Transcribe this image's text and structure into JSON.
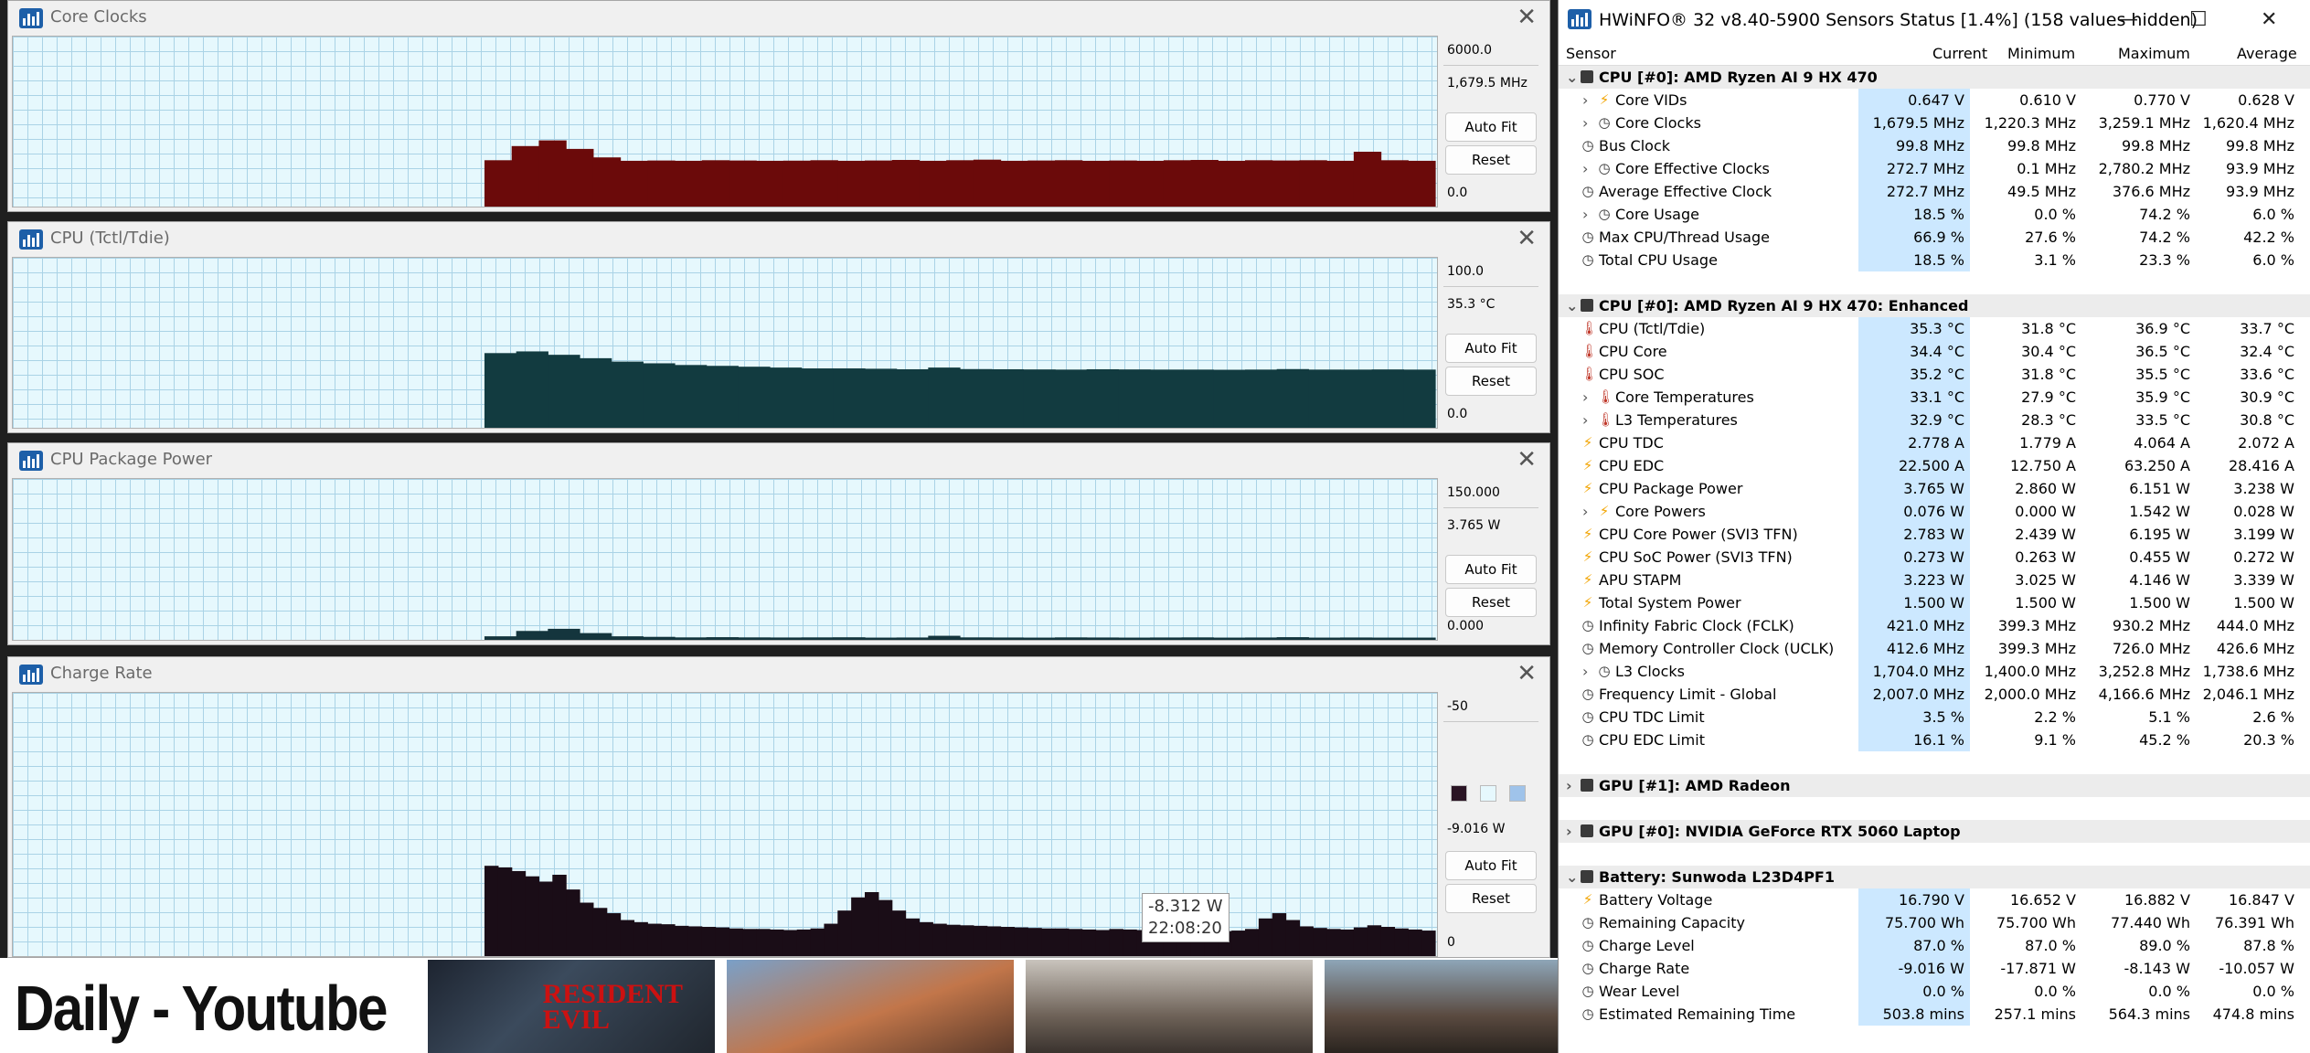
{
  "background": {
    "title": "Daily - Youtube",
    "thumbnail_caption": "RESIDENT EVIL"
  },
  "graphs": [
    {
      "title": "Core Clocks",
      "scale_max": "6000.0",
      "current": "1,679.5 MHz",
      "scale_min": "0.0",
      "fill_color": "#6b0a0a",
      "buttons": [
        "Auto Fit",
        "Reset"
      ],
      "chart_data": {
        "type": "area",
        "y_range": [
          0,
          6000
        ],
        "values": [
          1700,
          2200,
          2400,
          2100,
          1800,
          1680,
          1690,
          1680,
          1700,
          1690,
          1680,
          1685,
          1700,
          1680,
          1690,
          1710,
          1680,
          1700,
          1720,
          1680,
          1690,
          1700,
          1680,
          1690,
          1680,
          1700,
          1710,
          1680,
          1700,
          1690,
          1700,
          1680,
          2000,
          1700,
          1680
        ]
      }
    },
    {
      "title": "CPU (Tctl/Tdie)",
      "scale_max": "100.0",
      "current": "35.3 °C",
      "scale_min": "0.0",
      "fill_color": "#123b40",
      "buttons": [
        "Auto Fit",
        "Reset"
      ],
      "chart_data": {
        "type": "area",
        "y_range": [
          0,
          100
        ],
        "values": [
          45,
          46,
          44,
          42,
          40,
          39,
          38,
          37.5,
          37,
          36.5,
          36,
          36,
          35.8,
          35.5,
          36.5,
          35.6,
          35.5,
          35.4,
          35.3,
          35.5,
          35.4,
          35.3,
          35.3,
          35.2,
          35.3,
          35.6,
          35.3,
          35.3,
          35.4,
          35.3
        ]
      }
    },
    {
      "title": "CPU Package Power",
      "scale_max": "150.000",
      "current": "3.765 W",
      "scale_min": "0.000",
      "fill_color": "#14353d",
      "buttons": [
        "Auto Fit",
        "Reset"
      ],
      "chart_data": {
        "type": "area",
        "y_range": [
          0,
          150
        ],
        "values": [
          5,
          10,
          12,
          8,
          5,
          4.5,
          4,
          4.2,
          4,
          3.9,
          4,
          4.1,
          3.8,
          3.9,
          5.5,
          4,
          3.9,
          3.8,
          4,
          3.9,
          3.8,
          3.9,
          4,
          3.8,
          3.9,
          4.2,
          3.8,
          3.9,
          3.8,
          3.8
        ]
      }
    },
    {
      "title": "Charge Rate",
      "scale_max": "-50",
      "current": "-9.016 W",
      "scale_min": "0",
      "fill_color": "#1a0d17",
      "buttons": [
        "Auto Fit",
        "Reset"
      ],
      "tooltip_value": "-8.312 W",
      "tooltip_time": "22:08:20",
      "chart_data": {
        "type": "area",
        "y_range": [
          0,
          -50
        ],
        "values": [
          -17.5,
          -17.2,
          -16.5,
          -15.5,
          -14.5,
          -15.8,
          -13,
          -10.5,
          -9.5,
          -8.5,
          -7.2,
          -6.8,
          -6.5,
          -6.4,
          -6.1,
          -6,
          -5.9,
          -5.8,
          -5.6,
          -5.5,
          -5.5,
          -5.4,
          -5.3,
          -5.4,
          -5.6,
          -6.5,
          -9,
          -11.5,
          -12.5,
          -11,
          -9,
          -7.5,
          -6.8,
          -6.5,
          -6.3,
          -6.2,
          -6.1,
          -6,
          -5.9,
          -5.8,
          -5.7,
          -5.6,
          -5.6,
          -5.5,
          -5.4,
          -5.3,
          -5.5,
          -5.4,
          -5.3,
          -5.2,
          -5.4,
          -5.6,
          -5.3,
          -5.2,
          -5.1,
          -5.2,
          -5.5,
          -7.5,
          -8.5,
          -7.2,
          -6,
          -5.7,
          -5.5,
          -5.4,
          -5.8,
          -6.2,
          -5.9,
          -5.6,
          -5.4,
          -5.2
        ]
      }
    }
  ],
  "sensors": {
    "title": "HWiNFO® 32 v8.40-5900 Sensors Status [1.4%] (158 values hidden)",
    "window_buttons": [
      "—",
      "☐",
      "✕"
    ],
    "columns": [
      "Sensor",
      "Current",
      "Minimum",
      "Maximum",
      "Average"
    ],
    "rows": [
      {
        "type": "group",
        "name": "CPU [#0]: AMD Ryzen AI 9 HX 470",
        "expanded": true
      },
      {
        "type": "item",
        "name": "Core VIDs",
        "icon": "bolt",
        "sub": true,
        "cur": "0.647 V",
        "min": "0.610 V",
        "max": "0.770 V",
        "avg": "0.628 V"
      },
      {
        "type": "item",
        "name": "Core Clocks",
        "icon": "clock",
        "sub": true,
        "cur": "1,679.5 MHz",
        "min": "1,220.3 MHz",
        "max": "3,259.1 MHz",
        "avg": "1,620.4 MHz"
      },
      {
        "type": "item",
        "name": "Bus Clock",
        "icon": "clock",
        "cur": "99.8 MHz",
        "min": "99.8 MHz",
        "max": "99.8 MHz",
        "avg": "99.8 MHz"
      },
      {
        "type": "item",
        "name": "Core Effective Clocks",
        "icon": "clock",
        "sub": true,
        "cur": "272.7 MHz",
        "min": "0.1 MHz",
        "max": "2,780.2 MHz",
        "avg": "93.9 MHz"
      },
      {
        "type": "item",
        "name": "Average Effective Clock",
        "icon": "clock",
        "cur": "272.7 MHz",
        "min": "49.5 MHz",
        "max": "376.6 MHz",
        "avg": "93.9 MHz"
      },
      {
        "type": "item",
        "name": "Core Usage",
        "icon": "clock",
        "sub": true,
        "cur": "18.5 %",
        "min": "0.0 %",
        "max": "74.2 %",
        "avg": "6.0 %"
      },
      {
        "type": "item",
        "name": "Max CPU/Thread Usage",
        "icon": "clock",
        "cur": "66.9 %",
        "min": "27.6 %",
        "max": "74.2 %",
        "avg": "42.2 %"
      },
      {
        "type": "item",
        "name": "Total CPU Usage",
        "icon": "clock",
        "cur": "18.5 %",
        "min": "3.1 %",
        "max": "23.3 %",
        "avg": "6.0 %"
      },
      {
        "type": "blank"
      },
      {
        "type": "group",
        "name": "CPU [#0]: AMD Ryzen AI 9 HX 470: Enhanced",
        "expanded": true
      },
      {
        "type": "item",
        "name": "CPU (Tctl/Tdie)",
        "icon": "therm",
        "cur": "35.3 °C",
        "min": "31.8 °C",
        "max": "36.9 °C",
        "avg": "33.7 °C"
      },
      {
        "type": "item",
        "name": "CPU Core",
        "icon": "therm",
        "cur": "34.4 °C",
        "min": "30.4 °C",
        "max": "36.5 °C",
        "avg": "32.4 °C"
      },
      {
        "type": "item",
        "name": "CPU SOC",
        "icon": "therm",
        "cur": "35.2 °C",
        "min": "31.8 °C",
        "max": "35.5 °C",
        "avg": "33.6 °C"
      },
      {
        "type": "item",
        "name": "Core Temperatures",
        "icon": "therm",
        "sub": true,
        "cur": "33.1 °C",
        "min": "27.9 °C",
        "max": "35.9 °C",
        "avg": "30.9 °C"
      },
      {
        "type": "item",
        "name": "L3 Temperatures",
        "icon": "therm",
        "sub": true,
        "cur": "32.9 °C",
        "min": "28.3 °C",
        "max": "33.5 °C",
        "avg": "30.8 °C"
      },
      {
        "type": "item",
        "name": "CPU TDC",
        "icon": "bolt",
        "cur": "2.778 A",
        "min": "1.779 A",
        "max": "4.064 A",
        "avg": "2.072 A"
      },
      {
        "type": "item",
        "name": "CPU EDC",
        "icon": "bolt",
        "cur": "22.500 A",
        "min": "12.750 A",
        "max": "63.250 A",
        "avg": "28.416 A"
      },
      {
        "type": "item",
        "name": "CPU Package Power",
        "icon": "bolt",
        "cur": "3.765 W",
        "min": "2.860 W",
        "max": "6.151 W",
        "avg": "3.238 W"
      },
      {
        "type": "item",
        "name": "Core Powers",
        "icon": "bolt",
        "sub": true,
        "cur": "0.076 W",
        "min": "0.000 W",
        "max": "1.542 W",
        "avg": "0.028 W"
      },
      {
        "type": "item",
        "name": "CPU Core Power (SVI3 TFN)",
        "icon": "bolt",
        "cur": "2.783 W",
        "min": "2.439 W",
        "max": "6.195 W",
        "avg": "3.199 W"
      },
      {
        "type": "item",
        "name": "CPU SoC Power (SVI3 TFN)",
        "icon": "bolt",
        "cur": "0.273 W",
        "min": "0.263 W",
        "max": "0.455 W",
        "avg": "0.272 W"
      },
      {
        "type": "item",
        "name": "APU STAPM",
        "icon": "bolt",
        "cur": "3.223 W",
        "min": "3.025 W",
        "max": "4.146 W",
        "avg": "3.339 W"
      },
      {
        "type": "item",
        "name": "Total System Power",
        "icon": "bolt",
        "cur": "1.500 W",
        "min": "1.500 W",
        "max": "1.500 W",
        "avg": "1.500 W"
      },
      {
        "type": "item",
        "name": "Infinity Fabric Clock (FCLK)",
        "icon": "clock",
        "cur": "421.0 MHz",
        "min": "399.3 MHz",
        "max": "930.2 MHz",
        "avg": "444.0 MHz"
      },
      {
        "type": "item",
        "name": "Memory Controller Clock (UCLK)",
        "icon": "clock",
        "cur": "412.6 MHz",
        "min": "399.3 MHz",
        "max": "726.0 MHz",
        "avg": "426.6 MHz"
      },
      {
        "type": "item",
        "name": "L3 Clocks",
        "icon": "clock",
        "sub": true,
        "cur": "1,704.0 MHz",
        "min": "1,400.0 MHz",
        "max": "3,252.8 MHz",
        "avg": "1,738.6 MHz"
      },
      {
        "type": "item",
        "name": "Frequency Limit - Global",
        "icon": "clock",
        "cur": "2,007.0 MHz",
        "min": "2,000.0 MHz",
        "max": "4,166.6 MHz",
        "avg": "2,046.1 MHz"
      },
      {
        "type": "item",
        "name": "CPU TDC Limit",
        "icon": "clock",
        "cur": "3.5 %",
        "min": "2.2 %",
        "max": "5.1 %",
        "avg": "2.6 %"
      },
      {
        "type": "item",
        "name": "CPU EDC Limit",
        "icon": "clock",
        "cur": "16.1 %",
        "min": "9.1 %",
        "max": "45.2 %",
        "avg": "20.3 %"
      },
      {
        "type": "blank"
      },
      {
        "type": "group",
        "name": "GPU [#1]: AMD Radeon",
        "expanded": false
      },
      {
        "type": "blank"
      },
      {
        "type": "group",
        "name": "GPU [#0]: NVIDIA GeForce RTX 5060 Laptop",
        "expanded": false
      },
      {
        "type": "blank"
      },
      {
        "type": "group",
        "name": "Battery: Sunwoda L23D4PF1",
        "expanded": true
      },
      {
        "type": "item",
        "name": "Battery Voltage",
        "icon": "bolt",
        "cur": "16.790 V",
        "min": "16.652 V",
        "max": "16.882 V",
        "avg": "16.847 V"
      },
      {
        "type": "item",
        "name": "Remaining Capacity",
        "icon": "clock",
        "cur": "75.700 Wh",
        "min": "75.700 Wh",
        "max": "77.440 Wh",
        "avg": "76.391 Wh"
      },
      {
        "type": "item",
        "name": "Charge Level",
        "icon": "clock",
        "cur": "87.0 %",
        "min": "87.0 %",
        "max": "89.0 %",
        "avg": "87.8 %"
      },
      {
        "type": "item",
        "name": "Charge Rate",
        "icon": "clock",
        "cur": "-9.016 W",
        "min": "-17.871 W",
        "max": "-8.143 W",
        "avg": "-10.057 W"
      },
      {
        "type": "item",
        "name": "Wear Level",
        "icon": "clock",
        "cur": "0.0 %",
        "min": "0.0 %",
        "max": "0.0 %",
        "avg": "0.0 %"
      },
      {
        "type": "item",
        "name": "Estimated Remaining Time",
        "icon": "clock",
        "cur": "503.8 mins",
        "min": "257.1 mins",
        "max": "564.3 mins",
        "avg": "474.8 mins"
      }
    ]
  }
}
